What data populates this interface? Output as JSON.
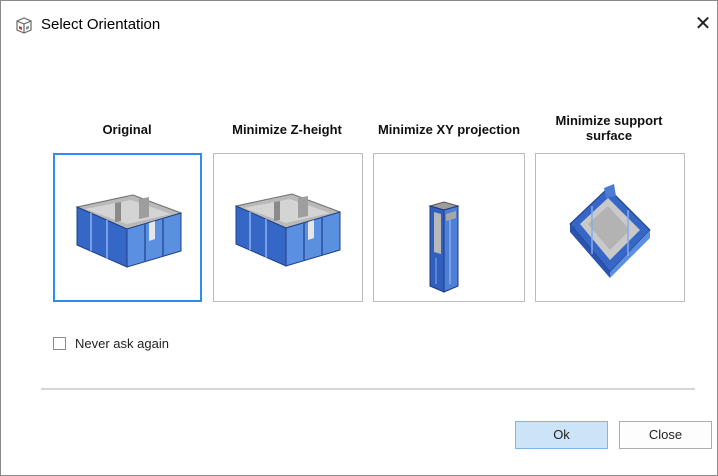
{
  "window": {
    "title": "Select Orientation",
    "close_glyph": "✕",
    "icon": "printer-box-icon"
  },
  "options": [
    {
      "label": "Original",
      "selected": true
    },
    {
      "label": "Minimize Z-height",
      "selected": false
    },
    {
      "label": "Minimize XY projection",
      "selected": false
    },
    {
      "label": "Minimize support surface",
      "selected": false
    }
  ],
  "never_ask": {
    "label": "Never ask again",
    "checked": false
  },
  "buttons": {
    "ok": "Ok",
    "close": "Close"
  },
  "colors": {
    "selection_border": "#2f8cf0",
    "ok_button_bg": "#cce4f7",
    "model_blue": "#2a64c8",
    "model_gray": "#a9a9a9"
  }
}
